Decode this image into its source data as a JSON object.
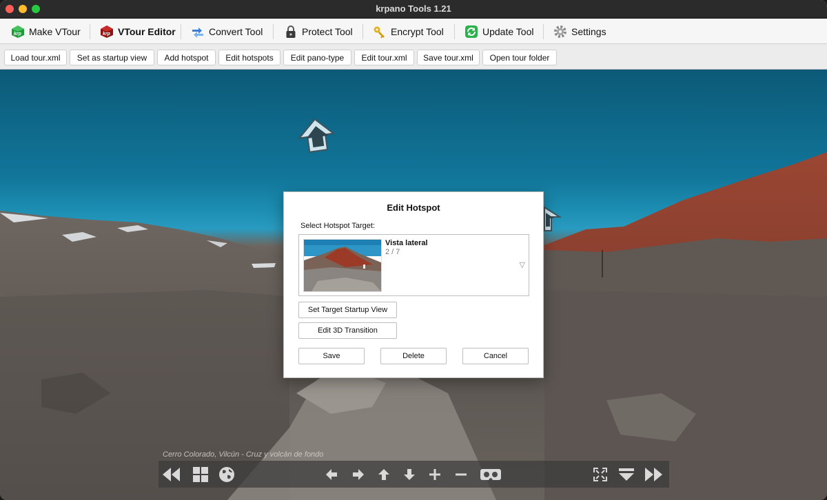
{
  "window": {
    "title": "krpano Tools 1.21"
  },
  "tools": [
    {
      "label": "Make VTour",
      "icon": "krpano-green-icon"
    },
    {
      "label": "VTour Editor",
      "icon": "krpano-red-icon"
    },
    {
      "label": "Convert Tool",
      "icon": "convert-arrows-icon"
    },
    {
      "label": "Protect Tool",
      "icon": "padlock-icon"
    },
    {
      "label": "Encrypt Tool",
      "icon": "key-icon"
    },
    {
      "label": "Update Tool",
      "icon": "refresh-icon"
    },
    {
      "label": "Settings",
      "icon": "gear-icon"
    }
  ],
  "active_tool": "VTour Editor",
  "actions": [
    "Load tour.xml",
    "Set as startup view",
    "Add hotspot",
    "Edit hotspots",
    "Edit pano-type",
    "Edit tour.xml",
    "Save tour.xml",
    "Open tour folder"
  ],
  "dialog": {
    "title": "Edit Hotspot",
    "select_label": "Select Hotspot Target:",
    "target": {
      "name": "Vista lateral",
      "index": "2 / 7"
    },
    "buttons": {
      "startup_view": "Set Target Startup View",
      "transition": "Edit 3D Transition",
      "save": "Save",
      "delete": "Delete",
      "cancel": "Cancel"
    }
  },
  "viewer": {
    "caption": "Cerro Colorado, Vilcún - Cruz y volcán de fondo",
    "controls": [
      "skip-back-icon",
      "thumbnails-grid-icon",
      "globe-icon",
      "arrow-left-icon",
      "arrow-right-icon",
      "arrow-up-icon",
      "arrow-down-icon",
      "zoom-in-icon",
      "zoom-out-icon",
      "vr-goggles-icon",
      "fullscreen-icon",
      "hide-controls-icon",
      "skip-forward-icon"
    ]
  },
  "colors": {
    "sky": "#127a9e",
    "ground": "#5f5954",
    "hill": "#8e3b2a",
    "accent_green": "#2bb24c"
  }
}
